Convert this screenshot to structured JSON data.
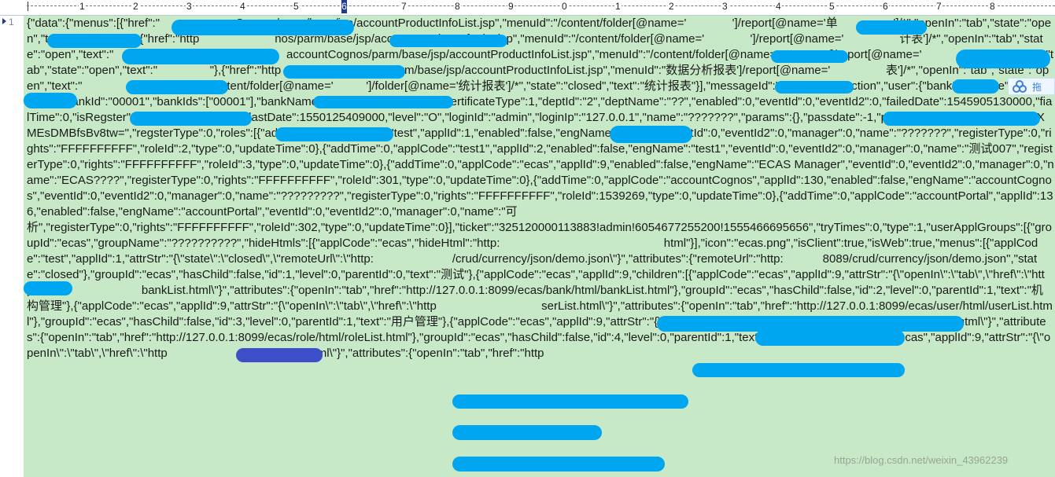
{
  "ruler": {
    "marks": [
      "1",
      "2",
      "3",
      "4",
      "5",
      "6",
      "7",
      "8",
      "9",
      "0",
      "1",
      "2",
      "3",
      "4",
      "5",
      "6",
      "7",
      "8"
    ]
  },
  "gutter": {
    "line_number": "1",
    "marker_icon": "bookmark-arrow-icon"
  },
  "editor": {
    "content": "{\"data\":{\"menus\":[{\"href\":\"                       Cognos/parm/base/jsp/accountProductInfoList.jsp\",\"menuId\":\"/content/folder[@name='              ']/report[@name='单                 ']/*\",\"openIn\":\"tab\",\"state\":\"open\",\"text\":\"                \"},{\"href\":\"http                       nos/parm/base/jsp/accountProductInfoList.jsp\",\"menuId\":\"/content/folder[@name='              ']/report[@name='                 计表']/*\",\"openIn\":\"tab\",\"state\":\"open\",\"text\":\"                \"},{\"href\":\"http:              accountCognos/parm/base/jsp/accountProductInfoList.jsp\",\"menuId\":\"/content/folder[@name='               ']/report[@name='                 ']/*\",\"openIn\":\"tab\",\"state\":\"open\",\"text\":\"                \"},{\"href\":\"http              untCognos/parm/base/jsp/accountProductInfoList.jsp\",\"menuId\":\"数据分析报表']/report[@name='                 表']/*\",\"openIn\":\"tab\",\"state\":\"open\",\"text\":\"                \"}],\"menuId\":\"/content/folder[@name='          ']/folder[@name='统计报表']/*\",\"state\":\"closed\",\"text\":\"统计报表\"}],\"messageId\":\"/getCMTree.action\",\"user\":{\"bankEngName\":\"MasterBank\",\"bankId\":\"00001\",\"bankIds\":[\"00001\"],\"bankName\":\"??\",\"certificateId\":\"1\",\"certificateType\":1,\"deptId\":\"2\",\"deptName\":\"??\",\"enabled\":0,\"eventId\":0,\"eventId2\":0,\"failedDate\":1545905130000,\"fialTime\":0,\"isRegster\":0,\"language\":\"zh-cn\",\"lastDate\":1550125409000,\"level\":\"O\",\"loginId\":\"admin\",\"loginIp\":\"127.0.0.1\",\"name\":\"???????\",\"params\":{},\"passdate\":-1,\"password\":\"EekIR3pSWPQ4xXMEsDMBfsBv8tw=\",\"regsterType\":0,\"roles\":[{\"addTime\":0,\"applCode\":\"test\",\"applId\":1,\"enabled\":false,\"engName\":\"TEST\",\"eventId\":0,\"eventId2\":0,\"manager\":0,\"name\":\"???????\",\"registerType\":0,\"rights\":\"FFFFFFFFFF\",\"roleId\":2,\"type\":0,\"updateTime\":0},{\"addTime\":0,\"applCode\":\"test1\",\"applId\":2,\"enabled\":false,\"engName\":\"test1\",\"eventId\":0,\"eventId2\":0,\"manager\":0,\"name\":\"测试007\",\"registerType\":0,\"rights\":\"FFFFFFFFFF\",\"roleId\":3,\"type\":0,\"updateTime\":0},{\"addTime\":0,\"applCode\":\"ecas\",\"applId\":9,\"enabled\":false,\"engName\":\"ECAS Manager\",\"eventId\":0,\"eventId2\":0,\"manager\":0,\"name\":\"ECAS????\",\"registerType\":0,\"rights\":\"FFFFFFFFFF\",\"roleId\":301,\"type\":0,\"updateTime\":0},{\"addTime\":0,\"applCode\":\"accountCognos\",\"applId\":130,\"enabled\":false,\"engName\":\"accountCognos\",\"eventId\":0,\"eventId2\":0,\"manager\":0,\"name\":\"?????????\",\"registerType\":0,\"rights\":\"FFFFFFFFFF\",\"roleId\":1539269,\"type\":0,\"updateTime\":0},{\"addTime\":0,\"applCode\":\"accountPortal\",\"applId\":136,\"enabled\":false,\"engName\":\"accountPortal\",\"eventId\":0,\"eventId2\":0,\"manager\":0,\"name\":\"可                                                                                                                                                                                                                      析\",\"registerType\":0,\"rights\":\"FFFFFFFFFF\",\"roleId\":302,\"type\":0,\"updateTime\":0}],\"ticket\":\"325120000113883!admin!6054677255200!1555466695656\",\"tryTimes\":0,\"type\":1,\"userApplGroups\":[{\"groupId\":\"ecas\",\"groupName\":\"??????????\",\"hideHtmls\":[{\"applCode\":\"ecas\",\"hideHtml\":\"http:                                                  html\"}],\"icon\":\"ecas.png\",\"isClient\":true,\"isWeb\":true,\"menus\":[{\"applCode\":\"test\",\"applId\":1,\"attrStr\":\"{\\\"state\\\":\\\"closed\\\",\\\"remoteUrl\\\":\\\"http:                        /crud/currency/json/demo.json\\\"}\",\"attributes\":{\"remoteUrl\":\"http:            8089/crud/currency/json/demo.json\",\"state\":\"closed\"},\"groupId\":\"ecas\",\"hasChild\":false,\"id\":1,\"level\":0,\"parentId\":0,\"text\":\"测试\"},{\"applCode\":\"ecas\",\"applId\":9,\"children\":[{\"applCode\":\"ecas\",\"applId\":9,\"attrStr\":\"{\\\"openIn\\\":\\\"tab\\\",\\\"href\\\":\\\"http:                                bankList.html\\\"}\",\"attributes\":{\"openIn\":\"tab\",\"href\":\"http://127.0.0.1:8099/ecas/bank/html/bankList.html\"},\"groupId\":\"ecas\",\"hasChild\":false,\"id\":2,\"level\":0,\"parentId\":1,\"text\":\"机构管理\"},{\"applCode\":\"ecas\",\"applId\":9,\"attrStr\":\"{\\\"openIn\\\":\\\"tab\\\",\\\"href\\\":\\\"http                                serList.html\\\"}\",\"attributes\":{\"openIn\":\"tab\",\"href\":\"http://127.0.0.1:8099/ecas/user/html/userList.html\"},\"groupId\":\"ecas\",\"hasChild\":false,\"id\":3,\"level\":0,\"parentId\":1,\"text\":\"用户管理\"},{\"applCode\":\"ecas\",\"applId\":9,\"attrStr\":\"{\\\"openIn\\\":\\\"tab\\\",\\\"href\\\":\\\"http                        html/roleList.html\\\"}\",\"attributes\":{\"openIn\":\"tab\",\"href\":\"http://127.0.0.1:8099/ecas/role/html/roleList.html\"},\"groupId\":\"ecas\",\"hasChild\":false,\"id\":4,\"level\":0,\"parentId\":1,\"text\":\"角色管理\"},{\"applCode\":\"ecas\",\"applId\":9,\"attrStr\":\"{\\\"openIn\\\":\\\"tab\\\",\\\"href\\\":\\\"http                                ogList.html\\\"}\",\"attributes\":{\"openIn\":\"tab\",\"href\":\"http"
  },
  "float_button": {
    "label": "拖",
    "icon": "cloud-share-icon"
  },
  "watermark": "https://blog.csdn.net/weixin_43962239",
  "colors": {
    "editor_bg": "#c7e9c7",
    "redaction": "#00a6ef",
    "link": "#1b3db5",
    "ruler_marker": "#1e3c8c"
  }
}
